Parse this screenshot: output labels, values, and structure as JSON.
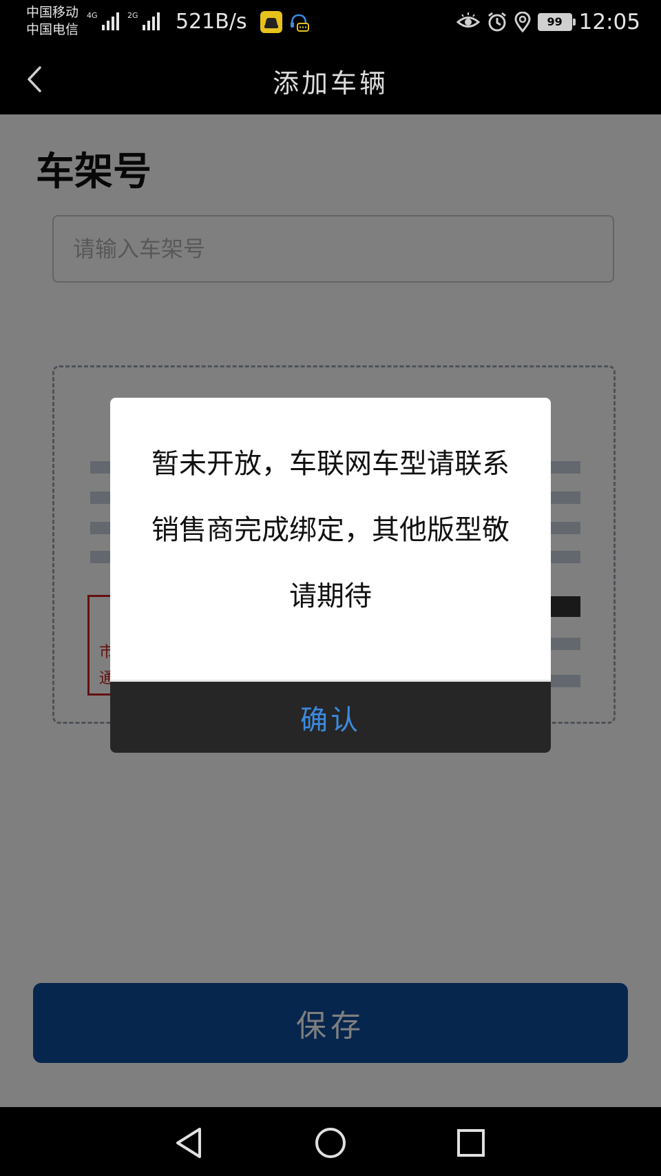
{
  "status_bar": {
    "carrier_1": "中国移动",
    "carrier_2": "中国电信",
    "network_1": "4G",
    "network_2": "2G",
    "net_speed": "521B/s",
    "battery": "99",
    "time": "12:05"
  },
  "header": {
    "title": "添加车辆",
    "back_icon": "chevron-left-icon"
  },
  "form": {
    "section_title": "车架号",
    "vin_placeholder": "请输入车架号",
    "stamp_line_1": "市",
    "stamp_line_2": "通",
    "save_label": "保存"
  },
  "dialog": {
    "message": "暂未开放，车联网车型请联系销售商完成绑定，其他版型敬请期待",
    "confirm_label": "确认"
  },
  "system_nav": {
    "back_icon": "triangle-back-icon",
    "home_icon": "circle-home-icon",
    "recents_icon": "square-recents-icon"
  },
  "colors": {
    "accent_blue": "#3c8be0",
    "save_button": "#0e4c9c",
    "stamp_red": "#c81e1e",
    "app_icon_yellow": "#e7c21d"
  }
}
